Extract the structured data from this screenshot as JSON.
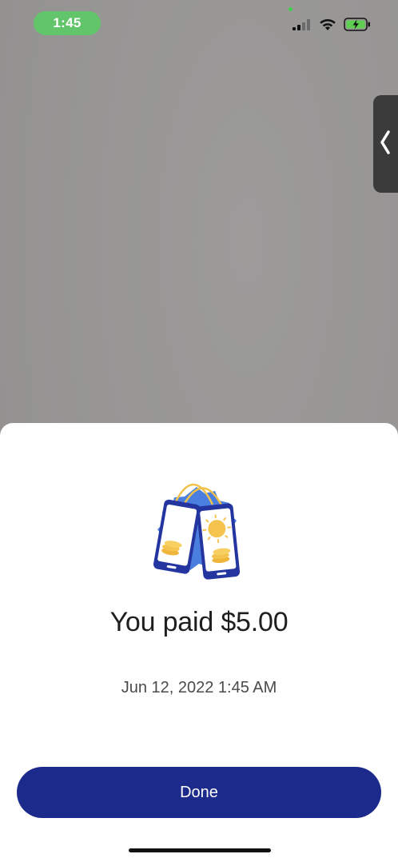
{
  "status_bar": {
    "time": "1:45",
    "icons": [
      "cellular-signal-icon",
      "wifi-icon",
      "battery-charging-icon"
    ]
  },
  "side_tab": {
    "icon": "chevron-left-icon"
  },
  "sheet": {
    "illustration": "phones-payment-illustration",
    "headline": "You paid $5.00",
    "timestamp": "Jun 12, 2022 1:45 AM",
    "done_label": "Done"
  },
  "colors": {
    "primary_button": "#1c2a8c",
    "status_pill": "#62c46b",
    "backdrop": "#979695"
  }
}
